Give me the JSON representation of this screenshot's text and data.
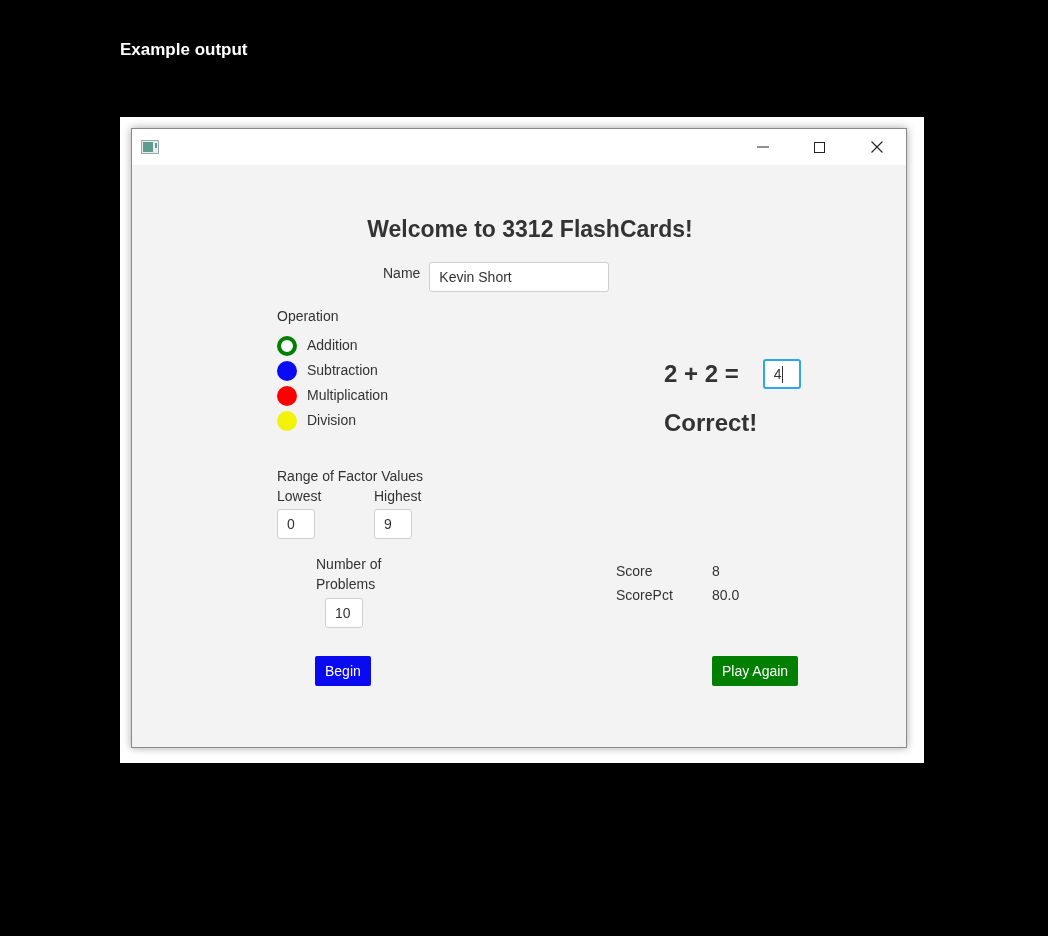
{
  "caption": "Example output",
  "heading": "Welcome to 3312 FlashCards!",
  "name": {
    "label": "Name",
    "value": "Kevin Short"
  },
  "operation": {
    "label": "Operation",
    "options": [
      {
        "label": "Addition",
        "color": "#008000",
        "selected": true
      },
      {
        "label": "Subtraction",
        "color": "#0a0af5",
        "selected": false
      },
      {
        "label": "Multiplication",
        "color": "#ff0000",
        "selected": false
      },
      {
        "label": "Division",
        "color": "#f2f20a",
        "selected": false
      }
    ]
  },
  "problem": {
    "equation": "2 + 2 =",
    "answer": "4",
    "focused": true
  },
  "feedback": "Correct!",
  "range": {
    "label": "Range of Factor Values",
    "lowest": {
      "label": "Lowest",
      "value": "0"
    },
    "highest": {
      "label": "Highest",
      "value": "9"
    }
  },
  "problems": {
    "label": "Number of Problems",
    "value": "10"
  },
  "score": [
    {
      "label": "Score",
      "value": "8"
    },
    {
      "label": "ScorePct",
      "value": "80.0"
    }
  ],
  "buttons": [
    {
      "label": "Begin",
      "color": "#0a0af0"
    },
    {
      "label": "Play Again",
      "color": "#007f00"
    }
  ]
}
